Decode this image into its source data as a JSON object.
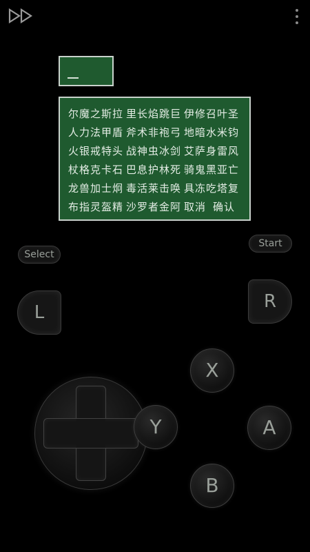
{
  "top_bar": {
    "fast_forward_icon": "fast-forward-icon",
    "menu_icon": "more-vertical-icon"
  },
  "game": {
    "name_entry": "_",
    "char_rows": [
      [
        "尔魔之斯拉",
        "里长焰跳巨",
        "伊修召叶圣"
      ],
      [
        "人力法甲盾",
        "斧术非袍弓",
        "地暗水米钧"
      ],
      [
        "火银戒特头",
        "战神虫冰剑",
        "艾萨身雷风"
      ],
      [
        "杖格克卡石",
        "巴息护林死",
        "骑鬼黑亚亡"
      ],
      [
        "龙兽加士炯",
        "毒活莱击唤",
        "具冻吃塔复"
      ],
      [
        "布指灵盔精",
        "沙罗者金阿",
        "取消  确认"
      ]
    ]
  },
  "controller": {
    "select_label": "Select",
    "start_label": "Start",
    "l_label": "L",
    "r_label": "R",
    "x_label": "X",
    "y_label": "Y",
    "a_label": "A",
    "b_label": "B"
  }
}
